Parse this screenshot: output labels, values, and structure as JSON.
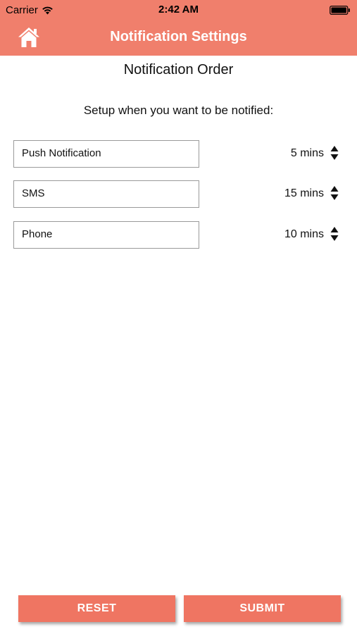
{
  "status_bar": {
    "carrier": "Carrier",
    "time": "2:42 AM",
    "wifi_icon": "wifi-icon",
    "battery_icon": "battery-icon"
  },
  "nav": {
    "title": "Notification Settings",
    "home_icon": "home-icon"
  },
  "main": {
    "section_title": "Notification Order",
    "instructions": "Setup when you want to be notified:",
    "methods": [
      {
        "label": "Push Notification",
        "time": "5 mins"
      },
      {
        "label": "SMS",
        "time": "15 mins"
      },
      {
        "label": "Phone",
        "time": "10 mins"
      }
    ]
  },
  "actions": {
    "reset_label": "RESET",
    "submit_label": "SUBMIT"
  },
  "colors": {
    "header_bg": "#f07f6c",
    "button_bg": "#ef7562",
    "text": "#111111"
  }
}
